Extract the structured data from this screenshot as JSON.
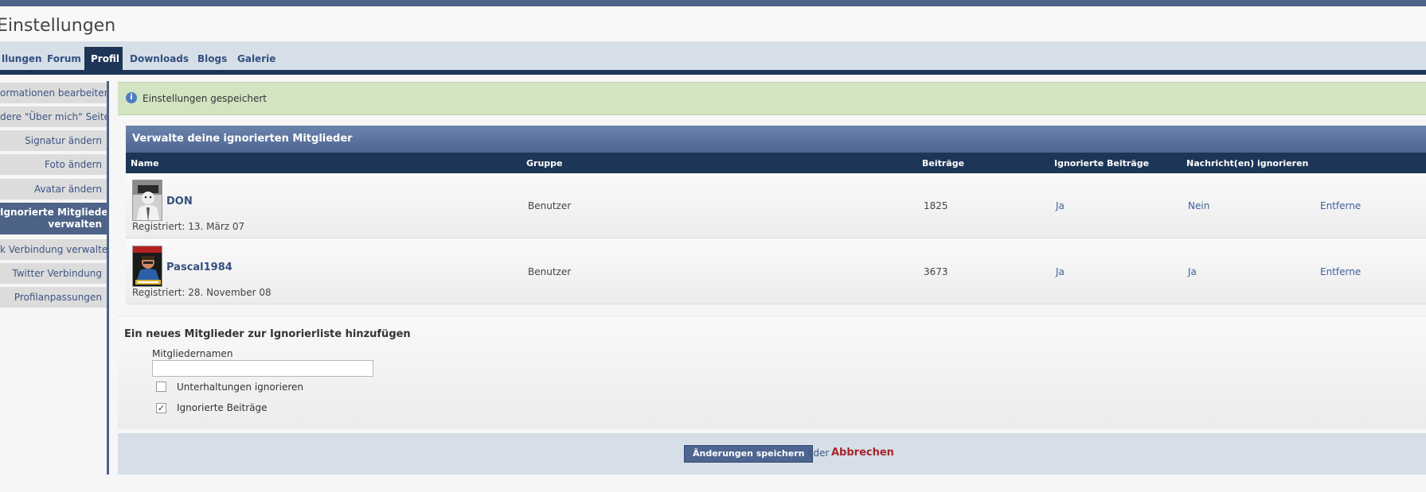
{
  "page": {
    "title": "Einstellungen"
  },
  "nav": {
    "tabs": [
      {
        "label": "llungen"
      },
      {
        "label": "Forum"
      },
      {
        "label": "Profil"
      },
      {
        "label": "Downloads"
      },
      {
        "label": "Blogs"
      },
      {
        "label": "Galerie"
      }
    ],
    "active_tab": "Profil"
  },
  "sidebar": {
    "items": [
      {
        "label": "ormationen bearbeiten"
      },
      {
        "label": "dere \"Über mich\" Seite"
      },
      {
        "label": "Signatur ändern"
      },
      {
        "label": "Foto ändern"
      },
      {
        "label": "Avatar ändern"
      },
      {
        "label": "Ignorierte Mitglieder verwalten",
        "line1": "Ignorierte Mitglieder",
        "line2": "verwalten"
      },
      {
        "label": "k Verbindung verwalten"
      },
      {
        "label": "Twitter Verbindung"
      },
      {
        "label": "Profilanpassungen"
      }
    ],
    "active_item": "Ignorierte Mitglieder verwalten"
  },
  "notice": {
    "icon": "info-icon",
    "icon_glyph": "i",
    "text": "Einstellungen gespeichert"
  },
  "ignored_panel": {
    "title": "Verwalte deine ignorierten Mitglieder",
    "columns": [
      "Name",
      "Gruppe",
      "Beiträge",
      "Ignorierte Beiträge",
      "Nachricht(en) ignorieren"
    ],
    "rows": [
      {
        "name": "DON",
        "registered": "Registriert: 13. März 07",
        "group": "Benutzer",
        "posts": "1825",
        "ignored_posts": "Ja",
        "ignore_messages": "Nein",
        "action": "Entferne"
      },
      {
        "name": "Pascal1984",
        "registered": "Registriert: 28. November 08",
        "group": "Benutzer",
        "posts": "3673",
        "ignored_posts": "Ja",
        "ignore_messages": "Ja",
        "action": "Entferne"
      }
    ]
  },
  "add_member": {
    "title": "Ein neues Mitglieder zur Ignorierliste hinzufügen",
    "field_label": "Mitgliedernamen",
    "field_value": "",
    "options": [
      {
        "label": "Unterhaltungen ignorieren",
        "checked": false
      },
      {
        "label": "Ignorierte Beiträge",
        "checked": true
      }
    ],
    "check_glyph": "✓"
  },
  "footer": {
    "save_label": "Änderungen speichern",
    "or_text": "oder",
    "cancel_label": "Abbrechen"
  },
  "colors": {
    "accent": "#1d3556",
    "header": "#4d6388",
    "notice_bg": "#d2e4c2",
    "cancel": "#a5262a"
  }
}
